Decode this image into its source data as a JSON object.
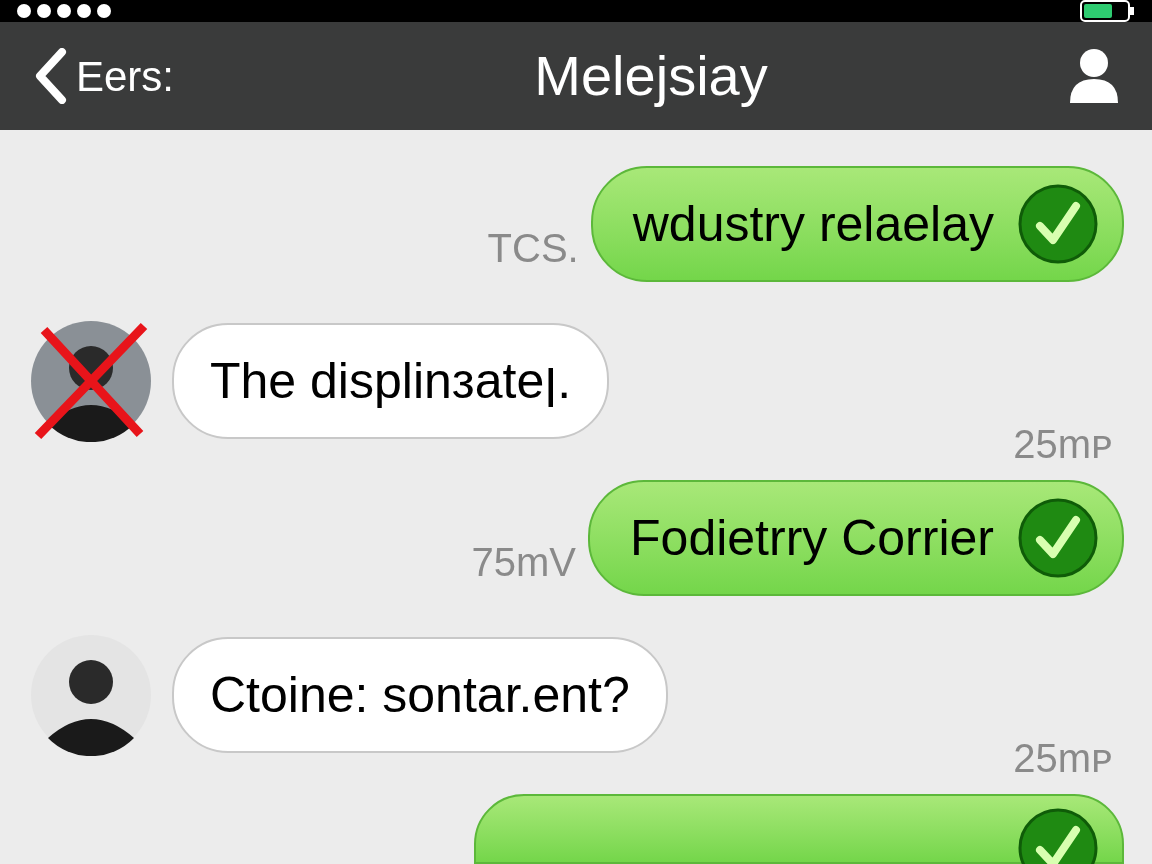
{
  "header": {
    "back_label": "Eers:",
    "title": "Meleјsiay"
  },
  "messages": [
    {
      "kind": "outgoing",
      "text": "wdustry relaelay",
      "time": "TCS.",
      "delivered": true
    },
    {
      "kind": "incoming",
      "text": "The displinзateן.",
      "time": "25mᴩ",
      "crossed": true
    },
    {
      "kind": "outgoing",
      "text": "Fodietrry Corrier",
      "time": "75mV",
      "delivered": true
    },
    {
      "kind": "incoming",
      "text": "Ctoine: sontar.ent?",
      "time": "25mᴩ",
      "crossed": false
    },
    {
      "kind": "outgoing",
      "delivered": true
    }
  ]
}
